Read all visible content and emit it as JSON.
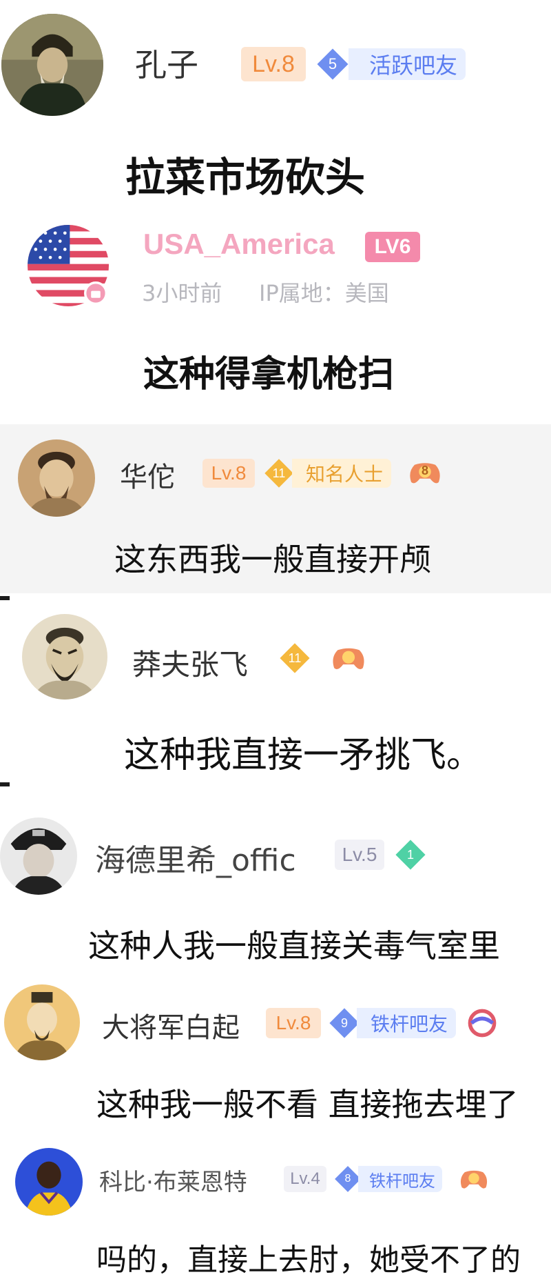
{
  "comments": [
    {
      "user": "孔子",
      "level": "Lv.8",
      "rank_num": "5",
      "rank_title": "活跃吧友",
      "text": "拉菜市场砍头",
      "avatar_icon": "confucius-portrait"
    },
    {
      "user": "USA_America",
      "level": "LV6",
      "time": "3小时前",
      "ip": "IP属地：美国",
      "text": "这种得拿机枪扫",
      "avatar_icon": "us-flag",
      "name_color": "#f4a6bf"
    },
    {
      "user": "华佗",
      "level": "Lv.8",
      "rank_num": "11",
      "rank_title": "知名人士",
      "extra_num": "8",
      "text": "这东西我一般直接开颅",
      "avatar_icon": "hua-tuo-portrait"
    },
    {
      "user": "莽夫张飞",
      "rank_num": "11",
      "text": "这种我直接一矛挑飞。",
      "avatar_icon": "zhang-fei-portrait"
    },
    {
      "user": "海德里希_offic",
      "level": "Lv.5",
      "rank_num": "1",
      "text": "这种人我一般直接关毒气室里",
      "avatar_icon": "officer-portrait"
    },
    {
      "user": "大将军白起",
      "level": "Lv.8",
      "rank_num": "9",
      "rank_title": "铁杆吧友",
      "text": "这种我一般不看 直接拖去埋了",
      "avatar_icon": "bai-qi-portrait"
    },
    {
      "user": "科比·布莱恩特",
      "level": "Lv.4",
      "rank_num": "8",
      "rank_title": "铁杆吧友",
      "text": "吗的，直接上去肘，她受不了的",
      "avatar_icon": "basketball-player-portrait"
    }
  ],
  "colors": {
    "level_bg": "#fde4cf",
    "level_fg": "#f08a3c",
    "rank_blue": "#5b7df0",
    "rank_gold": "#f5b83d",
    "gem_green": "#4fd1a5"
  }
}
